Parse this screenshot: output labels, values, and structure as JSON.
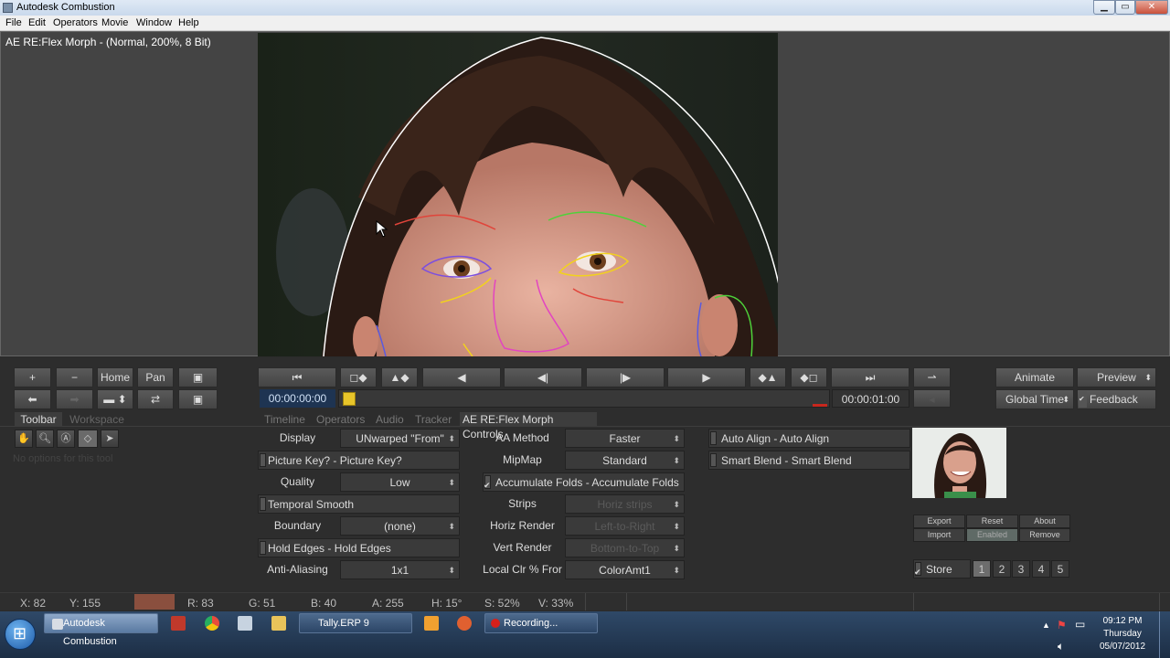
{
  "window": {
    "title": "Autodesk Combustion",
    "min": "▁",
    "max": "▭",
    "close": "✕"
  },
  "menu": [
    "File",
    "Edit",
    "Operators",
    "Movie",
    "Window",
    "Help"
  ],
  "viewer": {
    "title": "AE RE:Flex Morph -  (Normal, 200%, 8 Bit)"
  },
  "nav_buttons": {
    "plus": "+",
    "minus": "−",
    "home": "Home",
    "pan": "Pan"
  },
  "transport": {
    "start": "⏮",
    "prev_key": "◻◆",
    "prev_marker": "▲◆",
    "prev_frame": "◀",
    "back_play": "◀|",
    "play": "|▶",
    "fwd_frame": "▶",
    "next_marker": "◆▲",
    "next_key": "◆◻",
    "end": "⏭",
    "loop": "⇀",
    "current_time": "00:00:00:00",
    "end_time": "00:00:01:00"
  },
  "right_buttons": {
    "animate": "Animate",
    "preview": "Preview",
    "global_time": "Global Time",
    "feedback": "Feedback"
  },
  "left_tabs": [
    "Toolbar",
    "Workspace"
  ],
  "no_options": "No options for this tool",
  "center_tabs": [
    "Timeline",
    "Operators",
    "Audio",
    "Tracker",
    "AE RE:Flex Morph Controls"
  ],
  "controls": {
    "display_label": "Display",
    "display_value": "UNwarped \"From\"",
    "picture_key": "Picture Key? - Picture Key?",
    "quality_label": "Quality",
    "quality_value": "Low",
    "temporal_smooth": "Temporal Smooth",
    "boundary_label": "Boundary",
    "boundary_value": "(none)",
    "hold_edges": "Hold Edges - Hold Edges",
    "anti_aliasing_label": "Anti-Aliasing",
    "anti_aliasing_value": "1x1",
    "aa_method_label": "AA Method",
    "aa_method_value": "Faster",
    "mipmap_label": "MipMap",
    "mipmap_value": "Standard",
    "accumulate_folds": "Accumulate Folds - Accumulate Folds",
    "strips_label": "Strips",
    "strips_value": "Horiz strips",
    "horiz_render_label": "Horiz Render",
    "horiz_render_value": "Left-to-Right",
    "vert_render_label": "Vert Render",
    "vert_render_value": "Bottom-to-Top",
    "local_clr_label": "Local Clr % Fror",
    "local_clr_value": "ColorAmt1",
    "auto_align": "Auto Align - Auto Align",
    "smart_blend": "Smart Blend - Smart Blend"
  },
  "plugin_buttons": {
    "export": "Export",
    "reset": "Reset",
    "about": "About",
    "import": "Import",
    "enabled": "Enabled",
    "remove": "Remove"
  },
  "store": {
    "label": "Store",
    "slots": [
      "1",
      "2",
      "3",
      "4",
      "5"
    ]
  },
  "status": {
    "x": "X:   82",
    "y": "Y:  155",
    "r": "R: 83",
    "g": "G: 51",
    "b": "B: 40",
    "a": "A: 255",
    "h": "H: 15°",
    "s": "S: 52%",
    "v": "V: 33%",
    "swatch_color": "#8a4f3e"
  },
  "taskbar": {
    "tasks": [
      "Autodesk Combustion",
      "Tally.ERP 9",
      "Recording..."
    ],
    "time": "09:12 PM",
    "day": "Thursday",
    "date": "05/07/2012"
  }
}
